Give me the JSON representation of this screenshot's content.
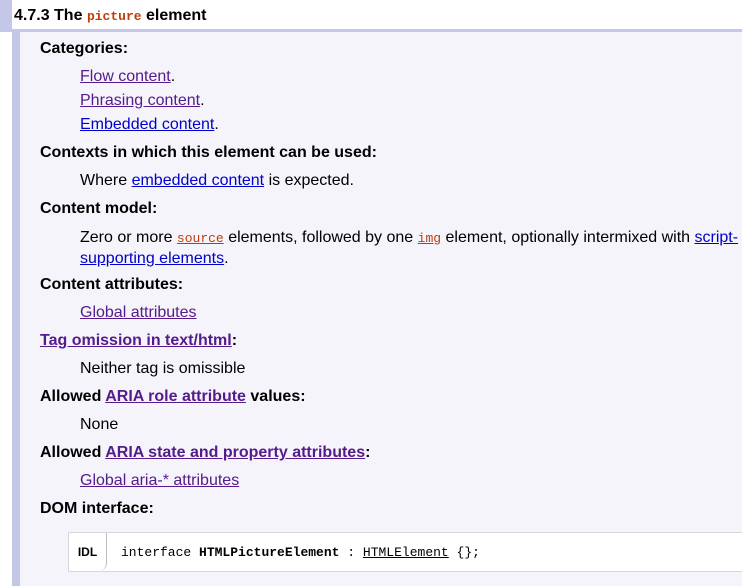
{
  "section": {
    "number": "4.7.3 The",
    "element_name": "picture",
    "suffix": "element"
  },
  "categories": {
    "label": "Categories:",
    "items": [
      {
        "text": "Flow content",
        "suffix": "."
      },
      {
        "text": "Phrasing content",
        "suffix": "."
      },
      {
        "text": "Embedded content",
        "suffix": "."
      }
    ]
  },
  "contexts": {
    "label": "Contexts in which this element can be used:",
    "prefix": "Where",
    "link": "embedded content",
    "suffix": "is expected."
  },
  "content_model": {
    "label": "Content model:",
    "prefix": "Zero or more",
    "source_code": "source",
    "middle": "elements, followed by one",
    "img_code": "img",
    "after": "element, optionally intermixed with",
    "link_line1": "script-",
    "link_line2": "supporting elements",
    "suffix": "."
  },
  "content_attributes": {
    "label": "Content attributes:",
    "link": "Global attributes"
  },
  "tag_omission": {
    "link": "Tag omission in text/html",
    "colon": ":",
    "value": "Neither tag is omissible"
  },
  "aria_role": {
    "prefix": "Allowed",
    "link": "ARIA role attribute",
    "suffix": "values:",
    "value": "None"
  },
  "aria_state": {
    "prefix": "Allowed",
    "link": "ARIA state and property attributes",
    "colon": ":",
    "value": "Global aria-* attributes"
  },
  "dom_interface": {
    "label": "DOM interface:",
    "idl_tag": "IDL",
    "keyword": "interface",
    "name": "HTMLPictureElement",
    "colon": ":",
    "parent": "HTMLElement",
    "tail": "{};"
  }
}
